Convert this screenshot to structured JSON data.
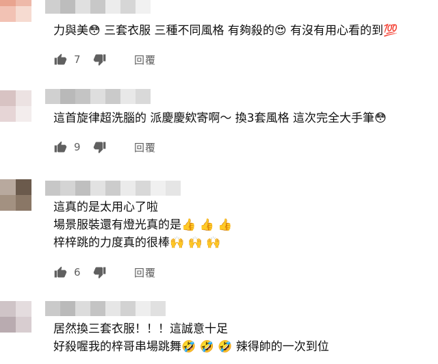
{
  "comments": [
    {
      "text_lines": [
        "力與美😳  三套衣服 三種不同風格 有夠殺的😍  有沒有用心看的到💯"
      ],
      "likes": "7",
      "reply_label": "回覆"
    },
    {
      "text_lines": [
        "這首旋律超洗腦的  派慶慶欸寄啊～ 換3套風格  這次完全大手筆😳"
      ],
      "likes": "9",
      "reply_label": "回覆"
    },
    {
      "text_lines": [
        "這真的是太用心了啦",
        "場景服裝還有燈光真的是👍 👍 👍",
        "梓梓跳的力度真的很棒🙌 🙌 🙌"
      ],
      "likes": "6",
      "reply_label": "回覆"
    },
    {
      "text_lines": [
        "居然換三套衣服！！！這誠意十足",
        "好殺喔我的梓哥串場跳舞🤣 🤣 🤣  辣得帥的一次到位"
      ],
      "likes": "",
      "reply_label": ""
    }
  ],
  "icons": {
    "like": "thumbs-up-icon",
    "dislike": "thumbs-down-icon"
  },
  "colors": {
    "text": "#0f0f0f",
    "secondary": "#606060",
    "icon": "#606060"
  }
}
